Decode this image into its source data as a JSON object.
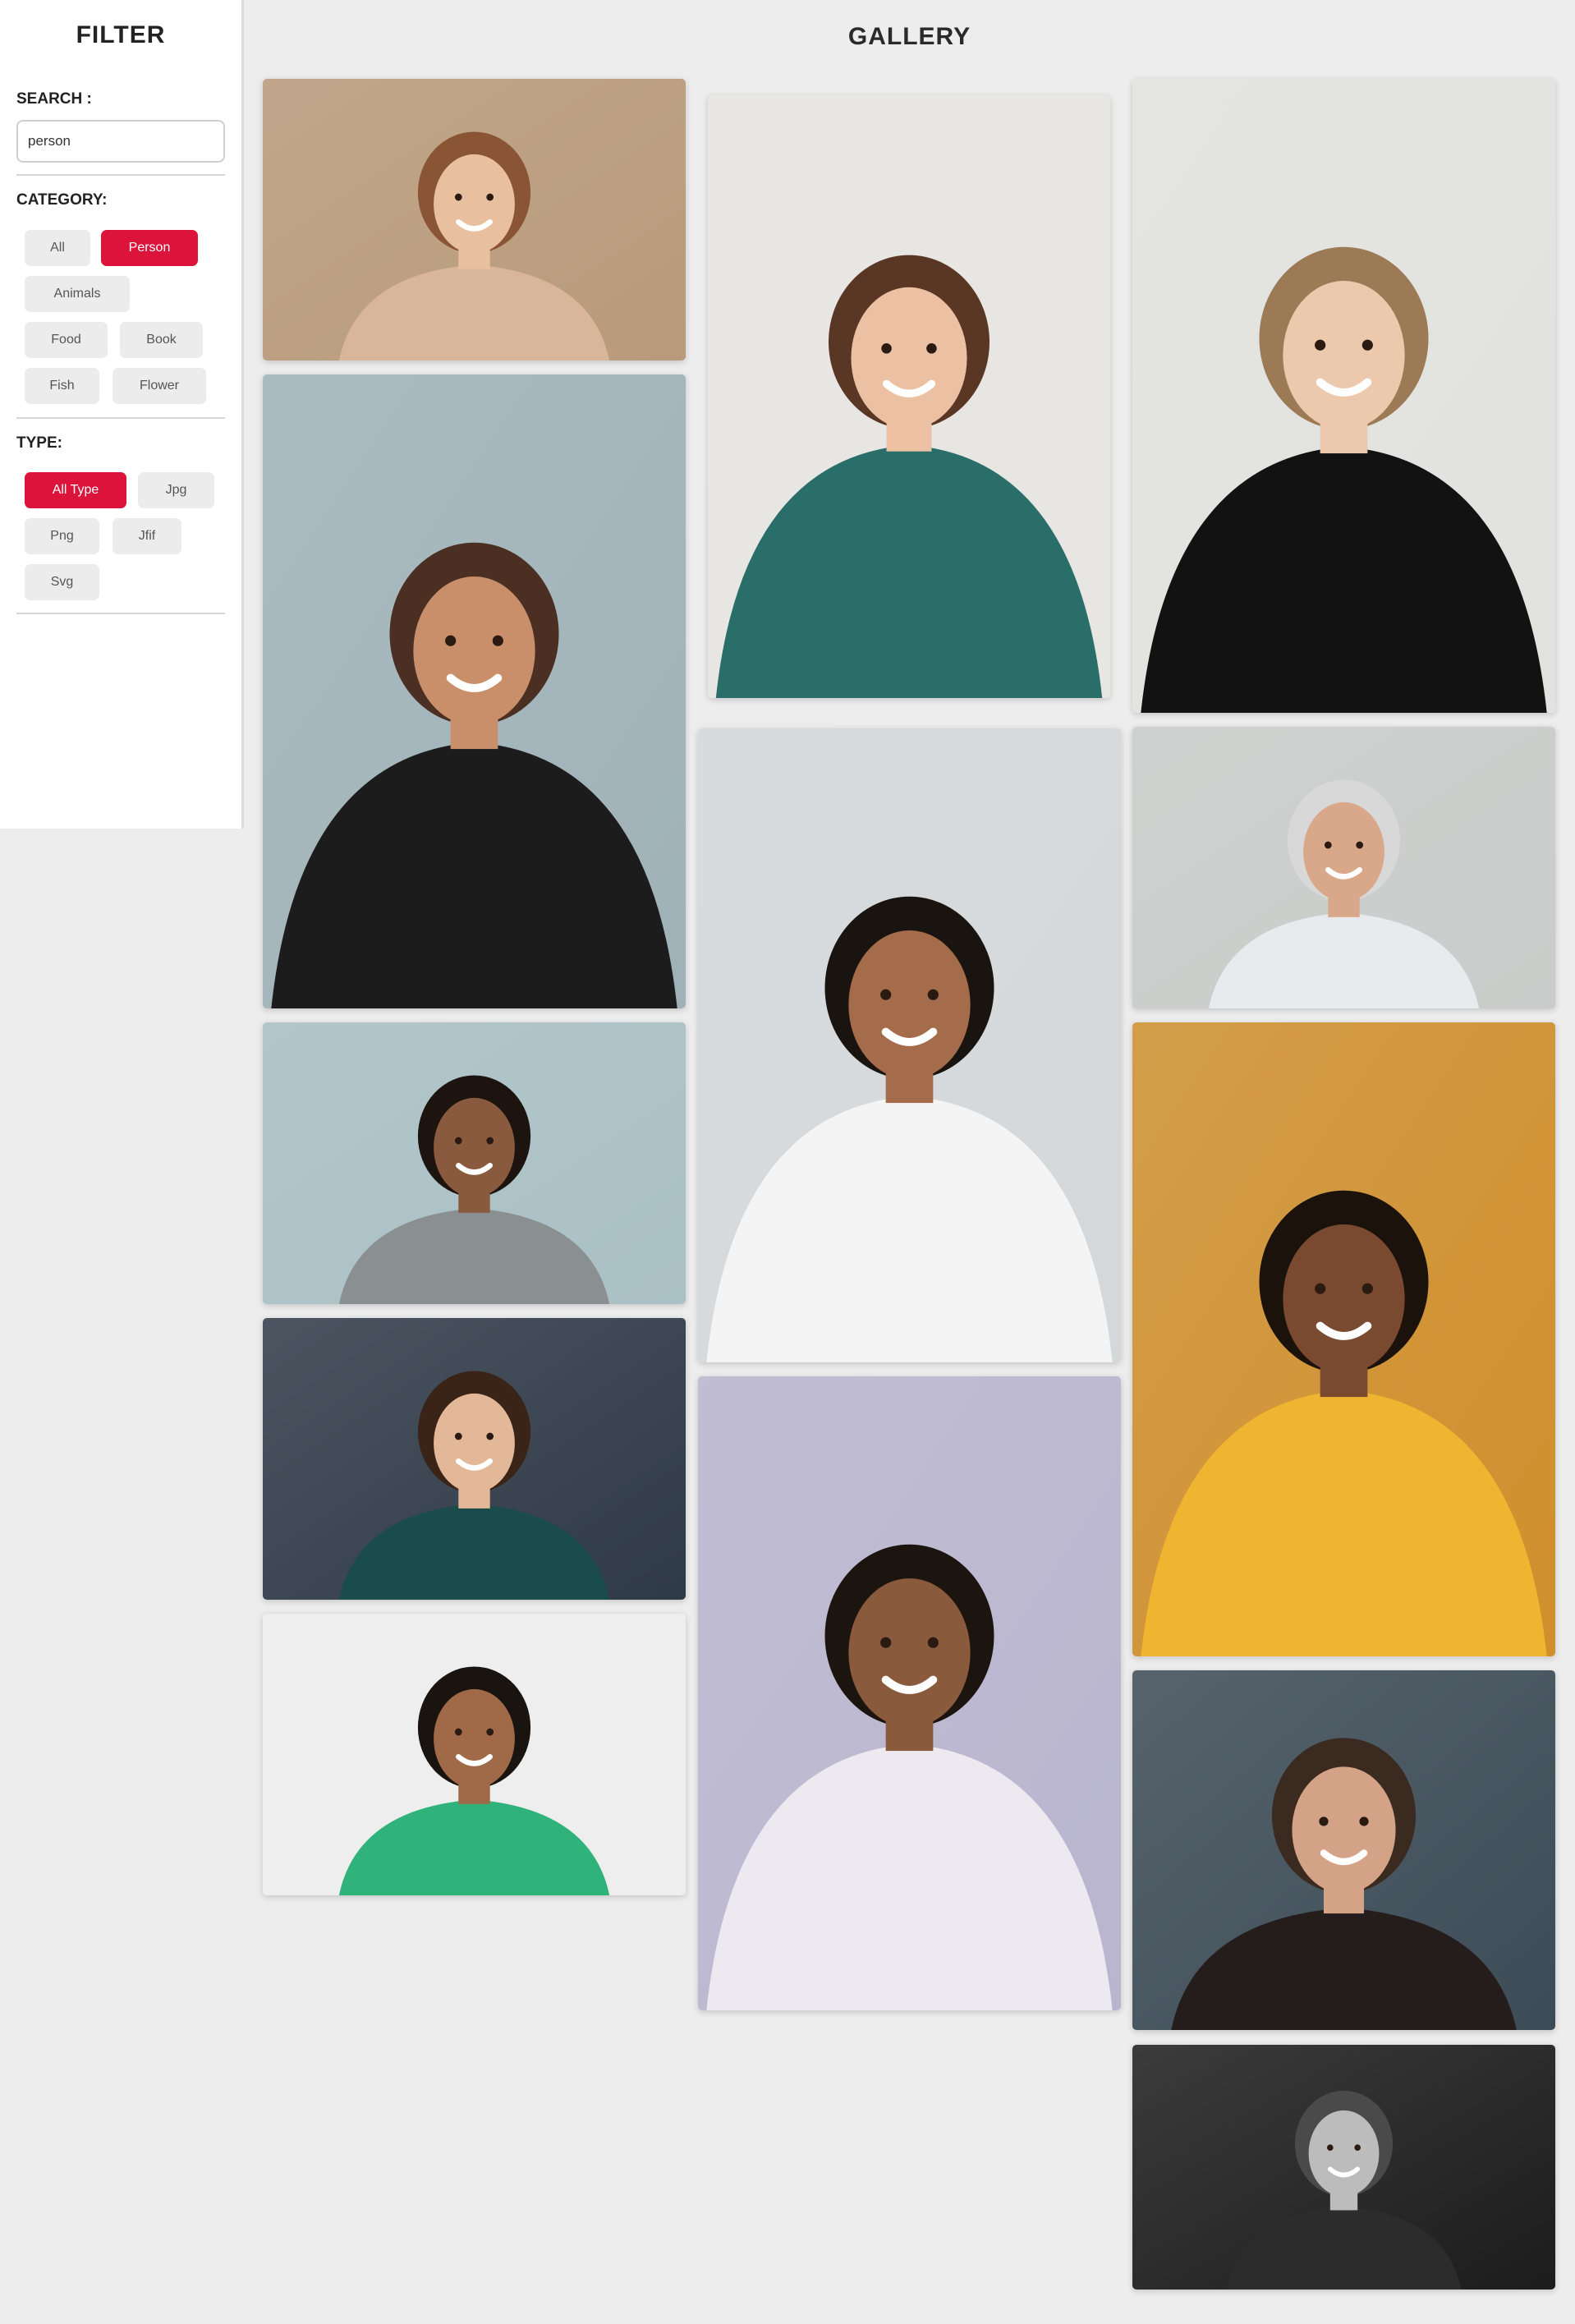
{
  "sidebar": {
    "title": "FILTER",
    "search_label": "SEARCH :",
    "search_value": "person",
    "category_label": "CATEGORY:",
    "categories": [
      {
        "label": "All",
        "active": false
      },
      {
        "label": "Person",
        "active": true
      },
      {
        "label": "Animals",
        "active": false
      },
      {
        "label": "Food",
        "active": false
      },
      {
        "label": "Book",
        "active": false
      },
      {
        "label": "Fish",
        "active": false
      },
      {
        "label": "Flower",
        "active": false
      }
    ],
    "type_label": "TYPE:",
    "types": [
      {
        "label": "All Type",
        "active": true
      },
      {
        "label": "Jpg",
        "active": false
      },
      {
        "label": "Png",
        "active": false
      },
      {
        "label": "Jfif",
        "active": false
      },
      {
        "label": "Svg",
        "active": false
      }
    ]
  },
  "gallery": {
    "title": "GALLERY",
    "photos": [
      {
        "name": "photo-woman-long-hair-outdoors",
        "bg": "#b99a7a",
        "skin": "#e8c0a0",
        "hair": "#8a5535",
        "shirt": "#d9b59a"
      },
      {
        "name": "photo-woman-striped-cardigan",
        "bg": "#9fb2b8",
        "skin": "#c98e6a",
        "hair": "#4a2f22",
        "shirt": "#1c1c1c"
      },
      {
        "name": "photo-woman-glasses-street",
        "bg": "#a9c0c4",
        "skin": "#8a5a3e",
        "hair": "#1e140f",
        "shirt": "#8a8f92"
      },
      {
        "name": "photo-woman-brick-wall",
        "bg": "#2f3a47",
        "skin": "#e2b899",
        "hair": "#3a2418",
        "shirt": "#1b4c4c"
      },
      {
        "name": "photo-man-green-tshirt",
        "bg": "#eeeeee",
        "skin": "#a06a48",
        "hair": "#1a1410",
        "shirt": "#2fb37a"
      },
      {
        "name": "photo-woman-smiling-curly",
        "bg": "#e8e6e2",
        "skin": "#ecc0a2",
        "hair": "#5a3625",
        "shirt": "#2a6e6a"
      },
      {
        "name": "photo-man-pointing-up",
        "bg": "#d4d8da",
        "skin": "#a46c4a",
        "hair": "#1a1410",
        "shirt": "#f4f4f4"
      },
      {
        "name": "photo-woman-holding-phone",
        "bg": "#b9b5cf",
        "skin": "#8a5a3c",
        "hair": "#1b140f",
        "shirt": "#eceaf0"
      },
      {
        "name": "photo-woman-black-blazer",
        "bg": "#e2e2df",
        "skin": "#ecc8ad",
        "hair": "#9b7a55",
        "shirt": "#121212"
      },
      {
        "name": "photo-older-man-office",
        "bg": "#c9ccca",
        "skin": "#d9a88a",
        "hair": "#d8d8d8",
        "shirt": "#e8ebee"
      },
      {
        "name": "photo-woman-yellow-jacket",
        "bg": "#cf8f2c",
        "skin": "#7a4a30",
        "hair": "#1b120c",
        "shirt": "#f0b530"
      },
      {
        "name": "photo-man-portrait-dark",
        "bg": "#3c4b56",
        "skin": "#d4a286",
        "hair": "#3a2a20",
        "shirt": "#241d1c"
      },
      {
        "name": "photo-man-black-white",
        "bg": "#1c1c1c",
        "skin": "#bcbcbc",
        "hair": "#4a4a4a",
        "shirt": "#2c2c2c"
      }
    ]
  }
}
